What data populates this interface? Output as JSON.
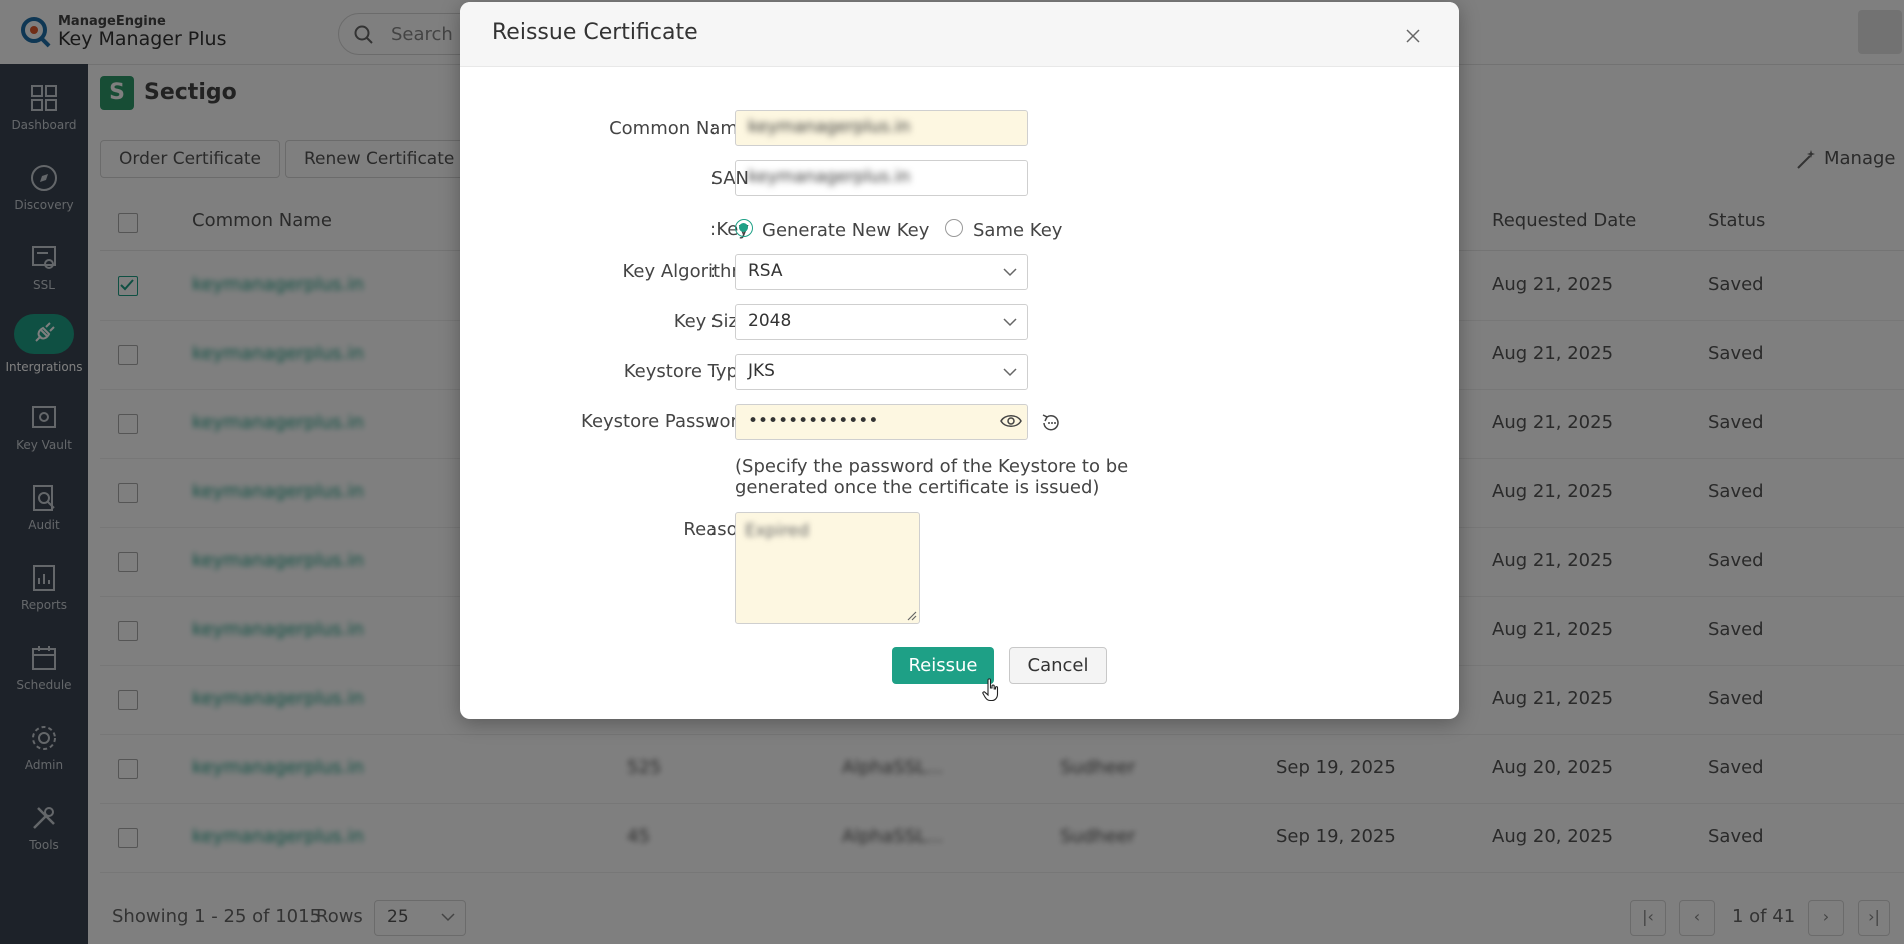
{
  "app": {
    "brand_small": "ManageEngine",
    "brand_name": "Key Manager Plus",
    "search_placeholder": "Search"
  },
  "sidebar": {
    "items": [
      {
        "label": "Dashboard",
        "icon": "grid-icon"
      },
      {
        "label": "Discovery",
        "icon": "compass-icon"
      },
      {
        "label": "SSL",
        "icon": "certificate-icon"
      },
      {
        "label": "Intergrations",
        "icon": "plug-icon",
        "active": true
      },
      {
        "label": "Key Vault",
        "icon": "vault-icon"
      },
      {
        "label": "Audit",
        "icon": "audit-icon"
      },
      {
        "label": "Reports",
        "icon": "reports-icon"
      },
      {
        "label": "Schedule",
        "icon": "calendar-icon"
      },
      {
        "label": "Admin",
        "icon": "gear-icon"
      },
      {
        "label": "Tools",
        "icon": "tools-icon"
      }
    ]
  },
  "page": {
    "title": "Sectigo",
    "logo_letter": "S",
    "toolbar": {
      "order": "Order Certificate",
      "renew": "Renew Certificate",
      "manage": "Manage"
    },
    "columns": {
      "common_name": "Common Name",
      "requested_date": "Requested Date",
      "status": "Status"
    },
    "rows": [
      {
        "name": "keymanagerplus.in",
        "order": "",
        "product": "",
        "requester": "",
        "expiry": "",
        "requested": "Aug 21, 2025",
        "status": "Saved",
        "checked": true
      },
      {
        "name": "keymanagerplus.in",
        "order": "",
        "product": "",
        "requester": "",
        "expiry": "",
        "requested": "Aug 21, 2025",
        "status": "Saved"
      },
      {
        "name": "keymanagerplus.in",
        "order": "",
        "product": "",
        "requester": "",
        "expiry": "",
        "requested": "Aug 21, 2025",
        "status": "Saved"
      },
      {
        "name": "keymanagerplus.in",
        "order": "",
        "product": "",
        "requester": "",
        "expiry": "",
        "requested": "Aug 21, 2025",
        "status": "Saved"
      },
      {
        "name": "keymanagerplus.in",
        "order": "",
        "product": "",
        "requester": "",
        "expiry": "",
        "requested": "Aug 21, 2025",
        "status": "Saved"
      },
      {
        "name": "keymanagerplus.in",
        "order": "",
        "product": "",
        "requester": "",
        "expiry": "",
        "requested": "Aug 21, 2025",
        "status": "Saved"
      },
      {
        "name": "keymanagerplus.in",
        "order": "",
        "product": "",
        "requester": "",
        "expiry": "",
        "requested": "Aug 21, 2025",
        "status": "Saved"
      },
      {
        "name": "keymanagerplus.in",
        "order": "525",
        "product": "AlphaSSL...",
        "requester": "Sudheer",
        "expiry": "Sep 19, 2025",
        "requested": "Aug 20, 2025",
        "status": "Saved"
      },
      {
        "name": "keymanagerplus.in",
        "order": "45",
        "product": "AlphaSSL...",
        "requester": "Sudheer",
        "expiry": "Sep 19, 2025",
        "requested": "Aug 20, 2025",
        "status": "Saved"
      }
    ],
    "footer": {
      "showing": "Showing 1 - 25 of 1015",
      "rows_label": "Rows",
      "rows_value": "25",
      "page_info": "1 of 41"
    }
  },
  "modal": {
    "title": "Reissue Certificate",
    "common_name": {
      "label": "Common Name",
      "value": "keymanagerplus.in"
    },
    "san": {
      "label": "SAN",
      "value": "keymanagerplus.in"
    },
    "key": {
      "label": "Key",
      "options": [
        "Generate New Key",
        "Same Key"
      ],
      "selected": "Generate New Key"
    },
    "key_algorithm": {
      "label": "Key Algorithm",
      "value": "RSA"
    },
    "key_size": {
      "label": "Key Size",
      "value": "2048"
    },
    "keystore_type": {
      "label": "Keystore Type",
      "value": "JKS"
    },
    "keystore_password": {
      "label": "Keystore Password",
      "value": "•••••••••••••"
    },
    "hint": "(Specify the password of the Keystore to be generated once the certificate is issued)",
    "reason": {
      "label": "Reason",
      "value": "Expired"
    },
    "buttons": {
      "reissue": "Reissue",
      "cancel": "Cancel"
    },
    "colon": ":"
  },
  "colors": {
    "accent": "#1ea086",
    "sidebar": "#3a4552",
    "field_yellow": "#fdf7e1"
  }
}
